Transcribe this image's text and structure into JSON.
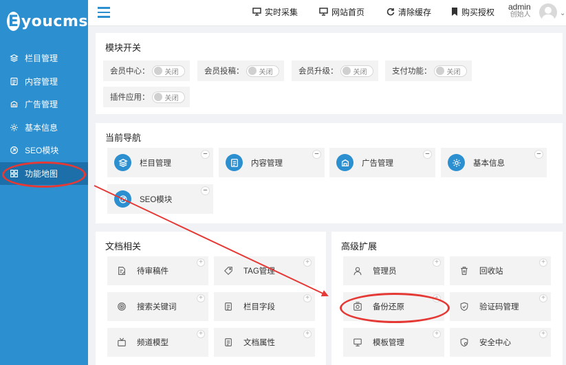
{
  "brand": {
    "logo_letter": "E",
    "logo_text": "youcms"
  },
  "sidebar": {
    "items": [
      {
        "label": "栏目管理",
        "icon": "layers-icon"
      },
      {
        "label": "内容管理",
        "icon": "document-icon"
      },
      {
        "label": "广告管理",
        "icon": "ad-icon"
      },
      {
        "label": "基本信息",
        "icon": "gear-icon"
      },
      {
        "label": "SEO模块",
        "icon": "seo-icon"
      },
      {
        "label": "功能地图",
        "icon": "grid-icon",
        "active": true
      }
    ]
  },
  "topbar": {
    "links": [
      {
        "label": "实时采集",
        "icon": "monitor-icon"
      },
      {
        "label": "网站首页",
        "icon": "monitor-icon"
      },
      {
        "label": "清除缓存",
        "icon": "refresh-icon"
      },
      {
        "label": "购买授权",
        "icon": "bookmark-icon"
      }
    ],
    "user": {
      "name": "admin",
      "role": "创始人"
    }
  },
  "modules": {
    "title": "模块开关",
    "switches": [
      {
        "label": "会员中心：",
        "state": "关闭"
      },
      {
        "label": "会员投稿：",
        "state": "关闭"
      },
      {
        "label": "会员升级：",
        "state": "关闭"
      },
      {
        "label": "支付功能：",
        "state": "关闭"
      },
      {
        "label": "插件应用：",
        "state": "关闭"
      }
    ]
  },
  "current_nav": {
    "title": "当前导航",
    "items": [
      {
        "label": "栏目管理",
        "icon": "layers-icon"
      },
      {
        "label": "内容管理",
        "icon": "document-icon"
      },
      {
        "label": "广告管理",
        "icon": "ad-icon"
      },
      {
        "label": "基本信息",
        "icon": "gear-icon"
      },
      {
        "label": "SEO模块",
        "icon": "seo-icon"
      }
    ],
    "remove_symbol": "−"
  },
  "docs": {
    "title": "文档相关",
    "items": [
      {
        "label": "待审稿件",
        "icon": "edit-doc-icon"
      },
      {
        "label": "TAG管理",
        "icon": "tag-icon"
      },
      {
        "label": "搜索关键词",
        "icon": "target-icon"
      },
      {
        "label": "栏目字段",
        "icon": "list-doc-icon"
      },
      {
        "label": "频道模型",
        "icon": "tv-icon"
      },
      {
        "label": "文档属性",
        "icon": "list-doc-icon"
      }
    ],
    "add_symbol": "+"
  },
  "advanced": {
    "title": "高级扩展",
    "items": [
      {
        "label": "管理员",
        "icon": "user-icon"
      },
      {
        "label": "回收站",
        "icon": "trash-icon"
      },
      {
        "label": "备份还原",
        "icon": "backup-icon"
      },
      {
        "label": "验证码管理",
        "icon": "shield-icon"
      },
      {
        "label": "模板管理",
        "icon": "monitor-icon"
      },
      {
        "label": "安全中心",
        "icon": "security-icon"
      }
    ],
    "add_symbol": "+"
  },
  "colors": {
    "primary": "#2c8fd0",
    "sidebar_active": "#1c6fa8",
    "annotation": "#e53935"
  }
}
